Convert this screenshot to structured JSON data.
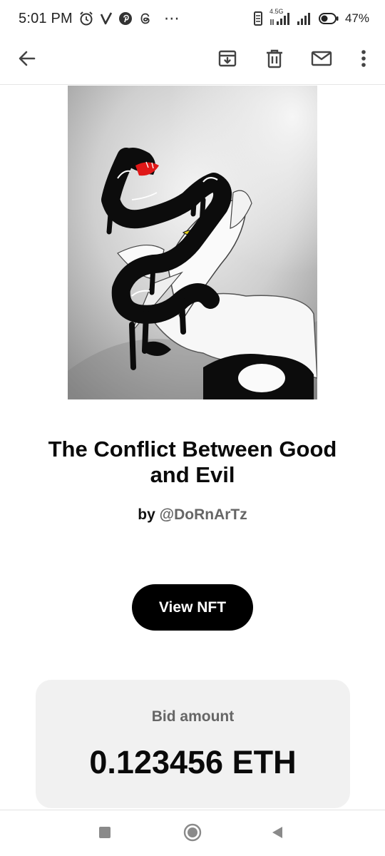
{
  "status_bar": {
    "time": "5:01 PM",
    "more_notifications": "⋯",
    "network_label": "4.5G",
    "battery_percent": "47%",
    "battery_level": 0.47,
    "icons": [
      "alarm-icon",
      "v-app-icon",
      "pinterest-icon",
      "threads-icon",
      "vibrate-icon",
      "signal-icon",
      "signal-icon-2",
      "battery-icon"
    ]
  },
  "toolbar": {
    "icons": [
      "back-arrow-icon",
      "archive-icon",
      "delete-icon",
      "mail-icon",
      "more-vert-icon"
    ]
  },
  "nft": {
    "title": "The Conflict Between Good and Evil",
    "by_label": "by",
    "creator_handle": "@DoRnArTz",
    "view_button_label": "View NFT"
  },
  "bid": {
    "label": "Bid amount",
    "amount": "0.123456 ETH"
  },
  "nav": {
    "icons": [
      "recents-square-icon",
      "home-circle-icon",
      "back-triangle-icon"
    ]
  },
  "colors": {
    "background": "#ffffff",
    "primary_text": "#0a0a0a",
    "secondary_text": "#666666",
    "button_bg": "#000000",
    "button_text": "#ffffff",
    "card_bg": "#f1f1f1",
    "snake_mouth": "#e01818",
    "eye": "#e8d21a"
  }
}
